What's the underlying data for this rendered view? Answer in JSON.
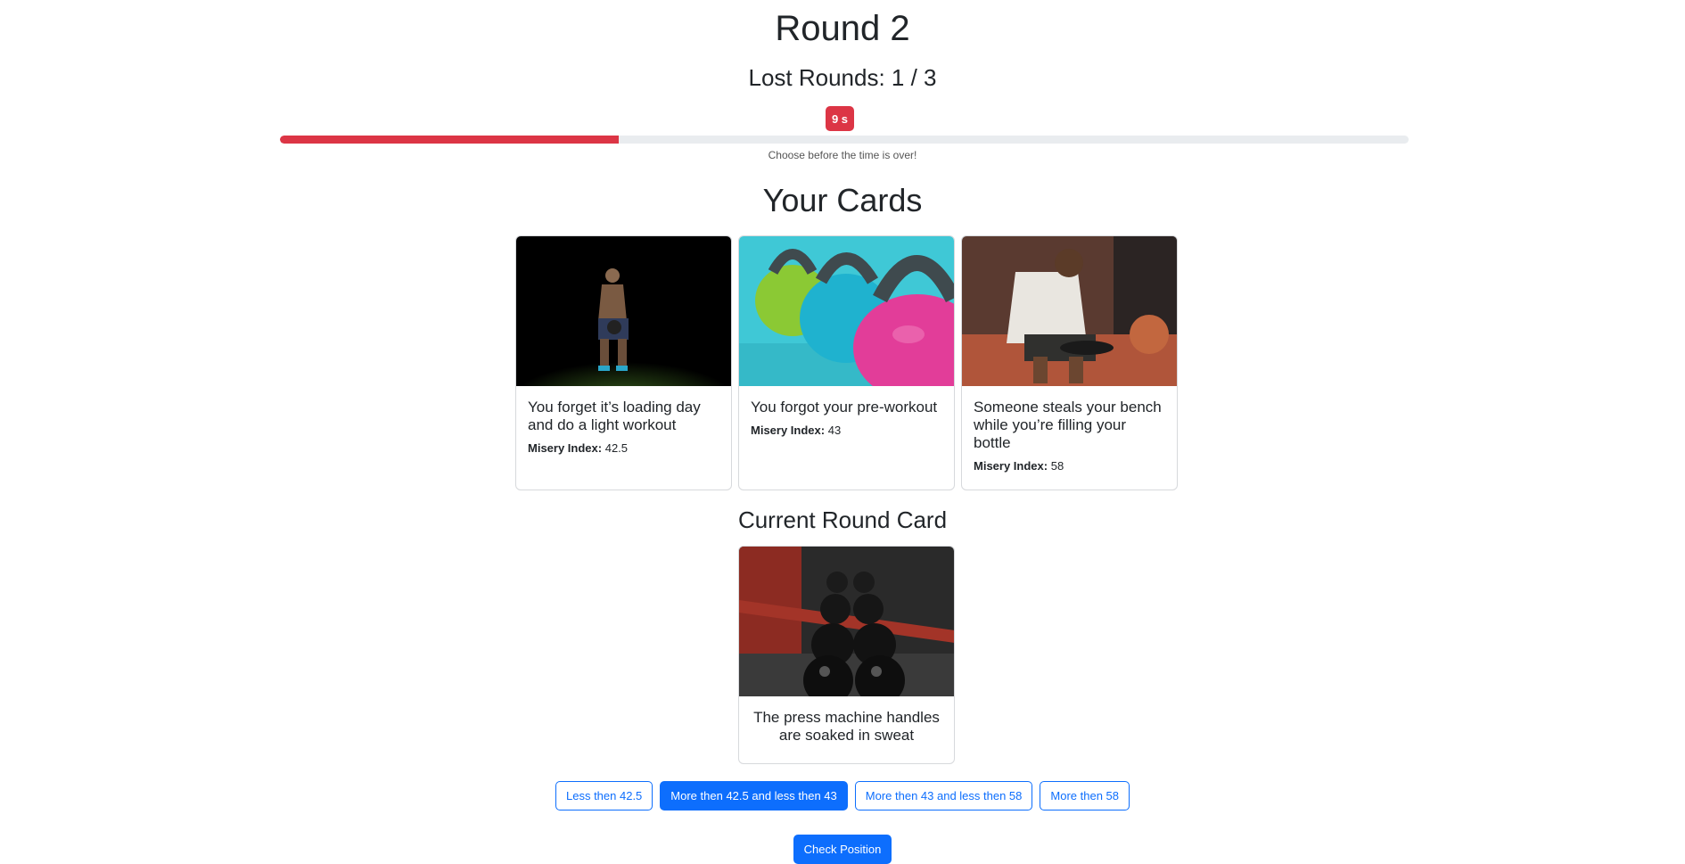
{
  "header": {
    "round_title": "Round 2",
    "lost_rounds": "Lost Rounds: 1 / 3"
  },
  "timer": {
    "badge": "9 s",
    "progress_fraction": 0.3,
    "hint": "Choose before the time is over!",
    "color": "#dc3545"
  },
  "your_cards": {
    "title": "Your Cards",
    "meta_label": "Misery Index:",
    "cards": [
      {
        "title": "You forget it’s loading day and do a light workout",
        "value": "42.5"
      },
      {
        "title": "You forgot your pre-workout",
        "value": "43"
      },
      {
        "title": "Someone steals your bench while you’re filling your bottle",
        "value": "58"
      }
    ]
  },
  "current": {
    "title": "Current Round Card",
    "card_title": "The press machine handles are soaked in sweat"
  },
  "options": [
    {
      "label": "Less then 42.5"
    },
    {
      "label": "More then 42.5 and less then 43",
      "selected": true
    },
    {
      "label": "More then 43 and less then 58"
    },
    {
      "label": "More then 58"
    }
  ],
  "actions": {
    "check_label": "Check Position"
  },
  "colors": {
    "primary": "#0d6efd",
    "danger": "#dc3545"
  }
}
